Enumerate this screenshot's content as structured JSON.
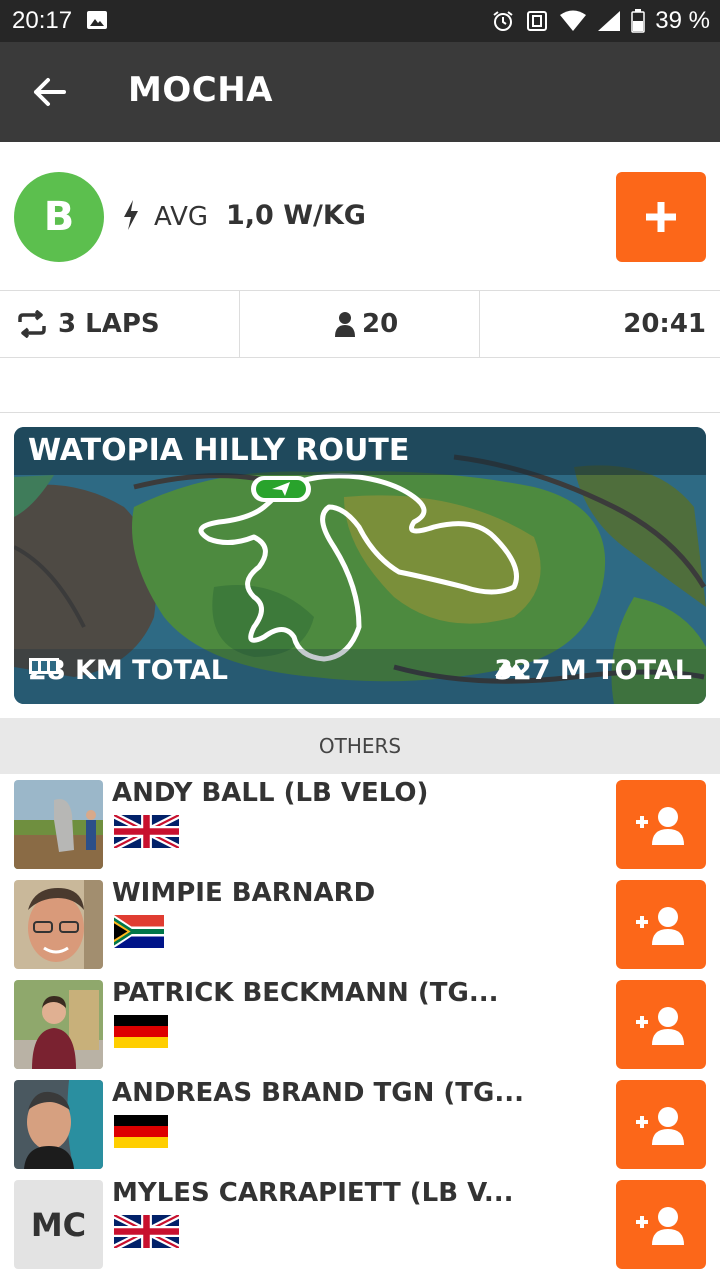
{
  "status_bar": {
    "time": "20:17",
    "battery": "39 %"
  },
  "header": {
    "title": "MOCHA"
  },
  "event": {
    "category": "B",
    "category_color": "#5cbf4e",
    "avg_label": "AVG",
    "avg_value": "1,0 W/KG",
    "laps": "3 LAPS",
    "riders": "20",
    "start_time": "20:41"
  },
  "route": {
    "name": "WATOPIA HILLY ROUTE",
    "distance": "28 KM TOTAL",
    "elevation": "327 M TOTAL"
  },
  "section": {
    "title": "OTHERS"
  },
  "riders": [
    {
      "name": "ANDY BALL (LB VELO)",
      "flag": "gb"
    },
    {
      "name": "WIMPIE BARNARD",
      "flag": "za"
    },
    {
      "name": "PATRICK BECKMANN (TG...",
      "flag": "de"
    },
    {
      "name": "ANDREAS BRAND TGN (TG...",
      "flag": "de"
    },
    {
      "name": "MYLES CARRAPIETT (LB V...",
      "flag": "gb",
      "initials": "MC"
    }
  ],
  "colors": {
    "accent": "#fc6719",
    "app_bar": "#3a3a3a",
    "status_bar": "#262626"
  }
}
